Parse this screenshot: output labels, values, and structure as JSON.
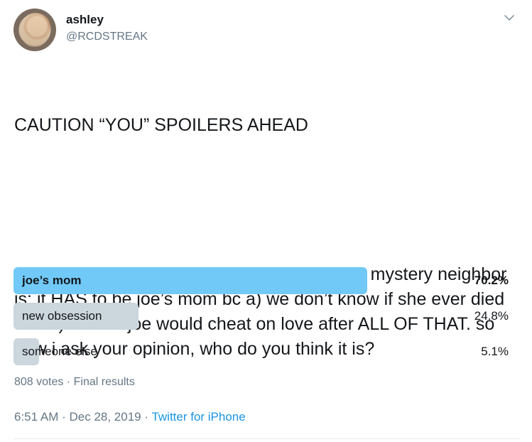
{
  "author": {
    "name": "ashley",
    "handle": "@RCDSTREAK"
  },
  "tweet": {
    "line1": "CAUTION “YOU” SPOILERS AHEAD",
    "line2": "okay no joke y’all i have a theory on who this mystery neighbor is: it HAS to be joe’s mom bc a) we don’t know if she ever died and b) i doubt joe would cheat on love after ALL OF THAT. so now i ask your opinion, who do you think it is?"
  },
  "poll": {
    "options": [
      {
        "label": "joe’s mom",
        "percent_text": "70.2%",
        "percent": 70.2,
        "winner": true
      },
      {
        "label": "new obsession",
        "percent_text": "24.8%",
        "percent": 24.8,
        "winner": false
      },
      {
        "label": "someone else",
        "percent_text": "5.1%",
        "percent": 5.1,
        "winner": false
      }
    ],
    "votes": "808 votes",
    "separator": " · ",
    "status": "Final results"
  },
  "meta": {
    "time": "6:51 AM",
    "separator": " · ",
    "date": "Dec 28, 2019",
    "source": "Twitter for iPhone"
  },
  "icons": {
    "caret": "chevron-down-icon"
  },
  "colors": {
    "winner_bar": "#71c9f8",
    "other_bar": "#ccd6dd",
    "secondary_text": "#657786",
    "link": "#1b95e0"
  }
}
